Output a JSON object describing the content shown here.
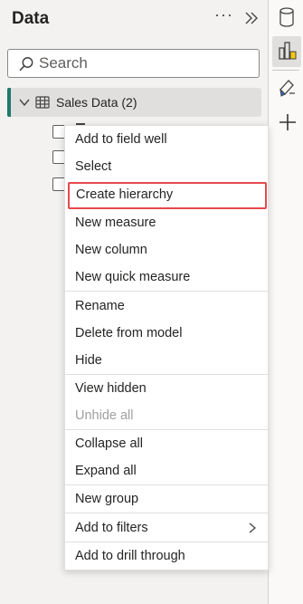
{
  "pane": {
    "title": "Data",
    "more_icon": "ellipsis-icon",
    "more_glyph": "···",
    "collapse_icon": "double-chevron-right-icon"
  },
  "search": {
    "placeholder": "Search",
    "value": ""
  },
  "tree": {
    "table_label": "Sales Data (2)",
    "table_icon": "table-icon",
    "expanded": true,
    "accent_color": "#1f7a6d"
  },
  "rail": {
    "items": [
      {
        "name": "data-icon"
      },
      {
        "name": "build-visual-icon"
      },
      {
        "name": "format-icon"
      },
      {
        "name": "add-icon"
      }
    ]
  },
  "menu": {
    "items": [
      {
        "label": "Add to field well"
      },
      {
        "label": "Select"
      },
      {
        "label": "Create hierarchy",
        "highlighted": true
      },
      {
        "label": "New measure"
      },
      {
        "label": "New column"
      },
      {
        "label": "New quick measure"
      },
      {
        "label": "Rename"
      },
      {
        "label": "Delete from model"
      },
      {
        "label": "Hide"
      },
      {
        "label": "View hidden"
      },
      {
        "label": "Unhide all",
        "disabled": true
      },
      {
        "label": "Collapse all"
      },
      {
        "label": "Expand all"
      },
      {
        "label": "New group"
      },
      {
        "label": "Add to filters",
        "submenu": true
      },
      {
        "label": "Add to drill through"
      }
    ],
    "highlight_color": "#e5484d"
  }
}
